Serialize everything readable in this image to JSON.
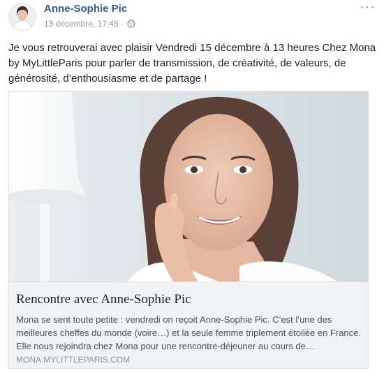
{
  "post": {
    "author": "Anne-Sophie Pic",
    "timestamp": "13 décembre, 17:45",
    "separator": "·",
    "privacy_icon": "globe-icon",
    "more_icon": "more-options-icon",
    "message": "Je vous retrouverai avec plaisir Vendredi 15 décembre à 13 heures Chez Mona by MyLittleParis pour parler de transmission, de créativité, de valeurs, de générosité, d’enthousiasme et de partage !"
  },
  "link_card": {
    "title": "Rencontre avec Anne-Sophie Pic",
    "description": "Mona se sent toute petite : vendredi on reçoit Anne-Sophie Pic. C’est l’une des meilleures cheffes du monde (voire…) et la seule femme triplement étoilée en France. Elle nous rejoindra chez Mona pour une rencontre-déjeuner au cours de…",
    "domain": "MONA.MYLITTLEPARIS.COM"
  },
  "colors": {
    "author_link": "#385898",
    "meta_gray": "#90949c",
    "card_footer_bg": "#f2f3f5",
    "border": "#dddfe2"
  }
}
